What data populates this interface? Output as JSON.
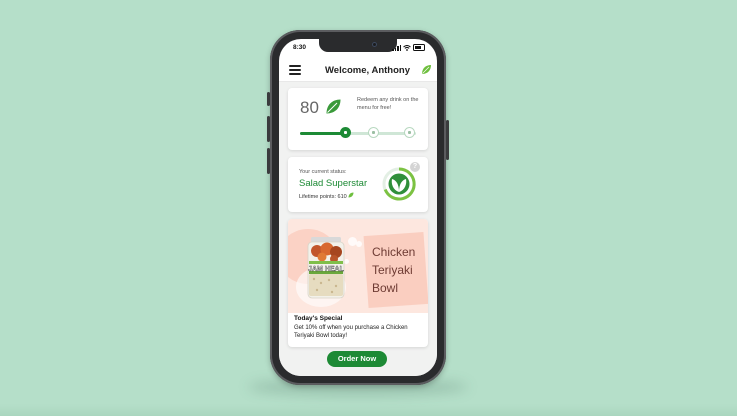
{
  "status_bar": {
    "time": "8:30"
  },
  "header": {
    "title": "Welcome, Anthony",
    "menu_icon": "hamburger-menu-icon",
    "title_icon": "leaf-icon"
  },
  "rewards": {
    "points": "80",
    "redeem_text": "Redeem any drink on the menu for free!",
    "progress_fraction": 0.4,
    "milestone_icons": [
      "drink-icon",
      "bowl-icon",
      "sandwich-icon"
    ]
  },
  "status": {
    "label": "Your current status:",
    "name": "Salad Superstar",
    "lifetime_points": "Lifetime points: 610",
    "badge_icon": "leaf-badge-icon",
    "help": "?"
  },
  "special": {
    "dish_name": "Chicken Teriyaki Bowl",
    "jar_text": "JAM HEAL",
    "heading": "Today's Special",
    "description": "Get 10% off when you purchase a Chicken Teriyaki Bowl today!"
  },
  "order_button": {
    "label": "Order Now"
  },
  "colors": {
    "brand_green": "#1d8a35",
    "background": "#b5dfc9",
    "special_bg": "#fde7df"
  }
}
